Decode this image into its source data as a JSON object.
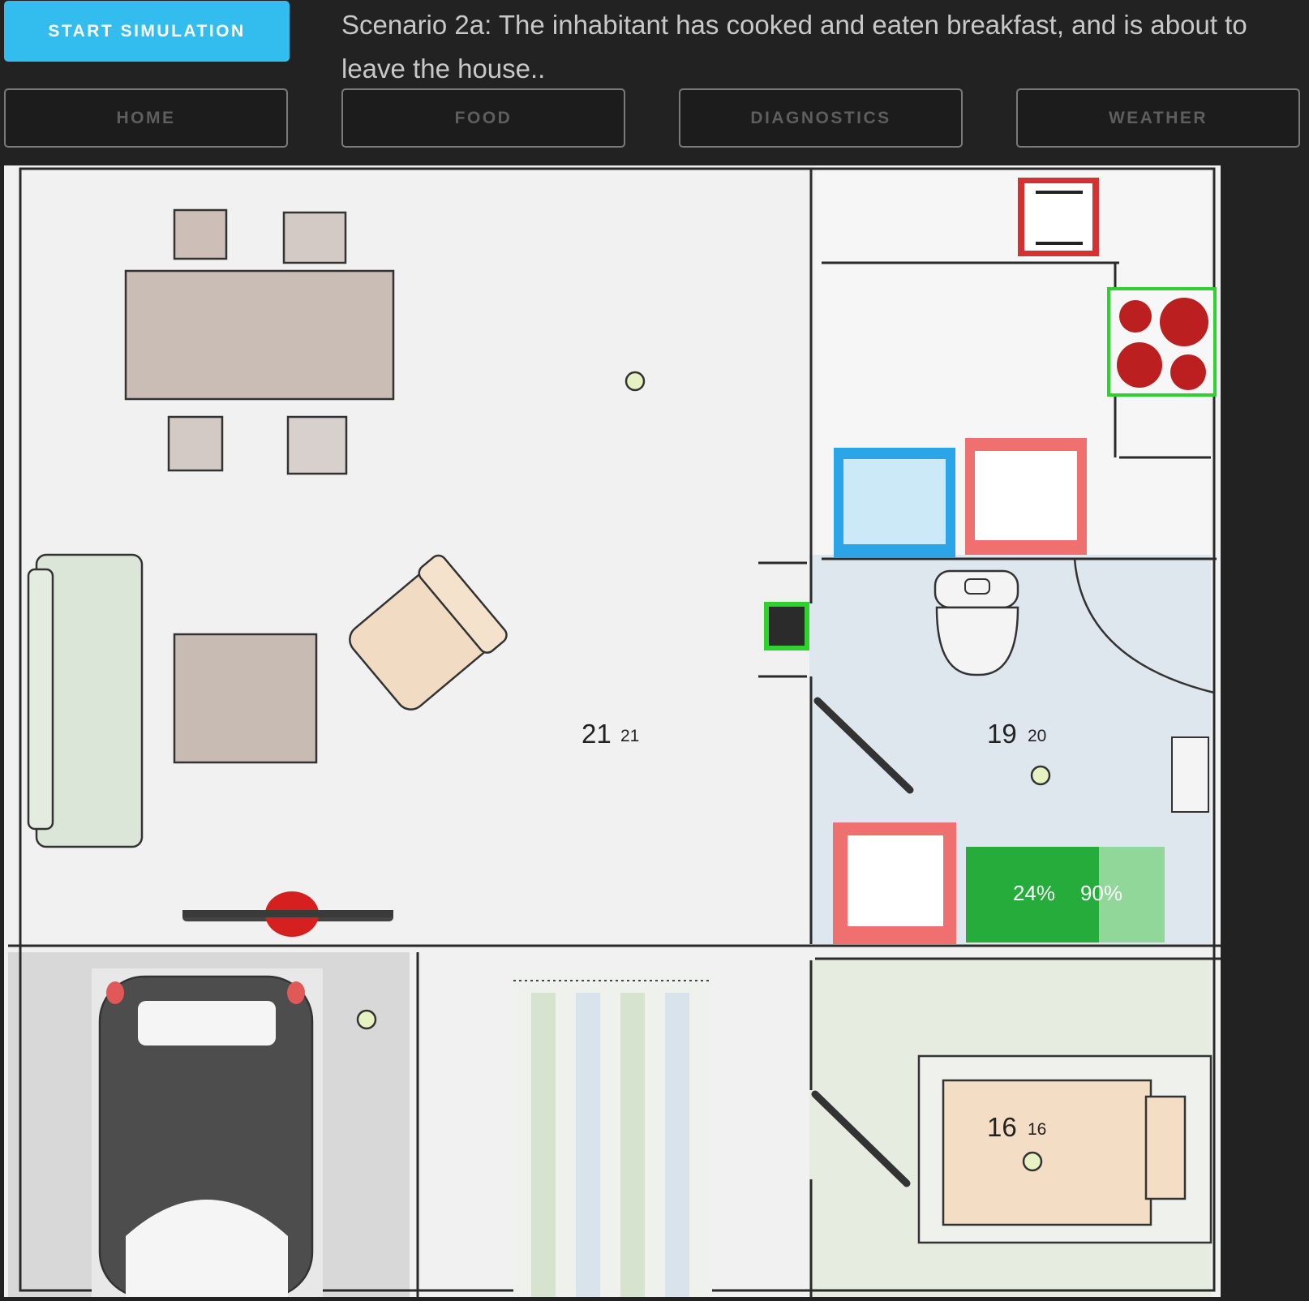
{
  "toolbar": {
    "start_label": "START SIMULATION",
    "scenario_text": "Scenario 2a: The inhabitant has cooked and eaten breakfast, and is about to leave the house.."
  },
  "nav": {
    "home": "HOME",
    "food": "FOOD",
    "diagnostics": "DIAGNOSTICS",
    "weather": "WEATHER"
  },
  "rooms": {
    "living": {
      "temp_current": "21",
      "temp_target": "21"
    },
    "bathroom": {
      "temp_current": "19",
      "temp_target": "20"
    },
    "bedroom": {
      "temp_current": "16",
      "temp_target": "16"
    }
  },
  "bathtub": {
    "level_a": "24%",
    "level_b": "90%"
  },
  "colors": {
    "accent": "#33bdee",
    "status_on": "#2fd12f",
    "status_off": "#f07070",
    "fridge_blue": "#2aa6e8",
    "stove_red": "#bb1f1f"
  }
}
